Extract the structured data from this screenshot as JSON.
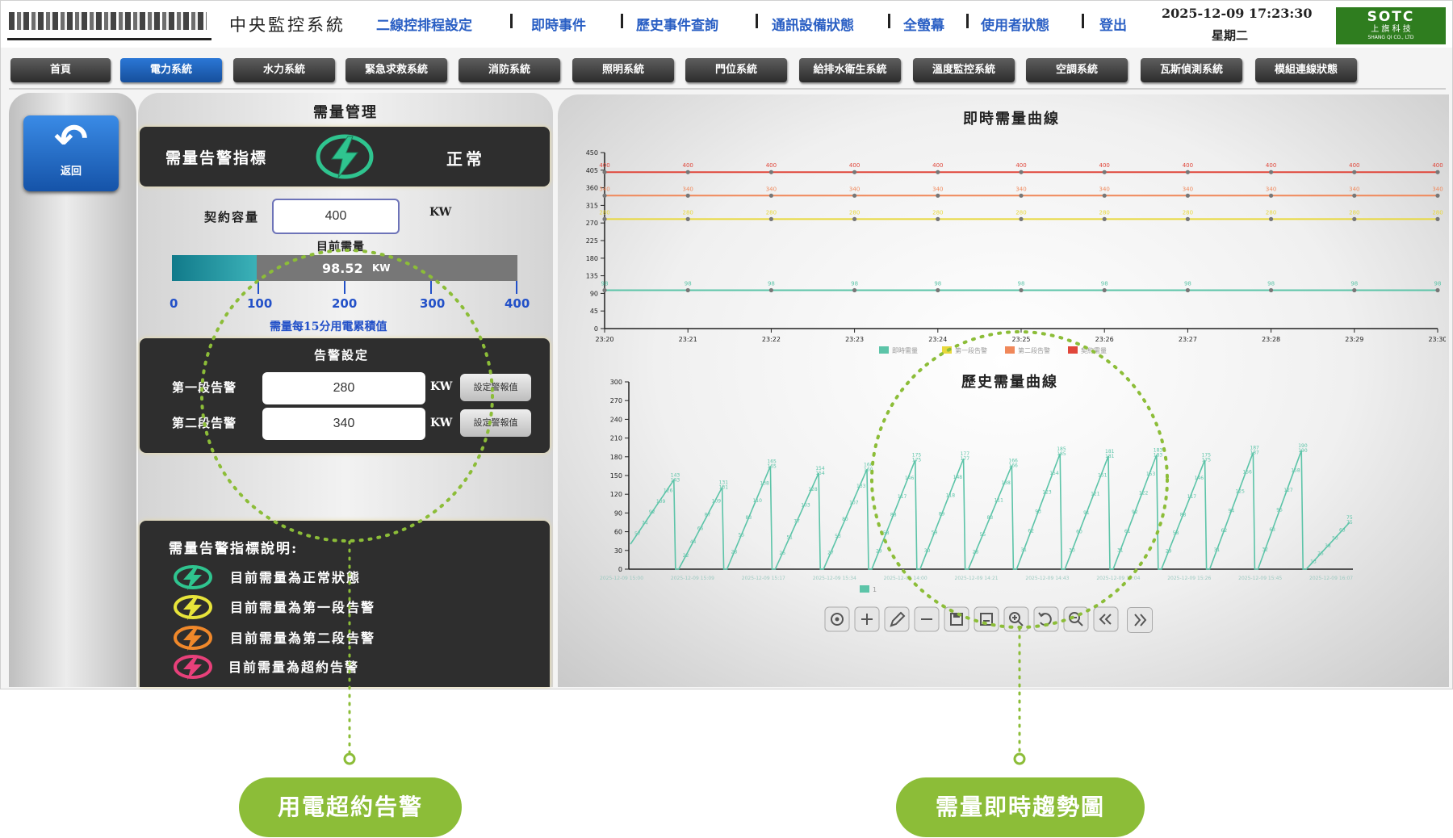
{
  "header": {
    "system_title": "中央監控系統",
    "nav": [
      "二線控排程設定",
      "即時事件",
      "歷史事件查詢",
      "通訊設備狀態",
      "全螢幕",
      "使用者狀態",
      "登出"
    ],
    "datetime": "2025-12-09 17:23:30",
    "weekday": "星期二",
    "brand_name": "SOTC",
    "brand_sub": "上 旗 科 技",
    "brand_sub2": "SHANG QI CO., LTD"
  },
  "tabs": [
    "首頁",
    "電力系統",
    "水力系統",
    "緊急求救系統",
    "消防系統",
    "照明系統",
    "門位系統",
    "給排水衛生系統",
    "溫度監控系統",
    "空調系統",
    "瓦斯偵測系統",
    "模組連線狀態"
  ],
  "active_tab": 1,
  "back_button": "返回",
  "demand": {
    "title": "需量管理",
    "indicator_label": "需量告警指標",
    "indicator_status": "正常",
    "indicator_color": "#2fc48f",
    "contract_label": "契約容量",
    "contract_value": "400",
    "unit": "KW",
    "current_label": "目前需量",
    "current_value": "98.52",
    "bar_fraction": 0.2463,
    "bar_ticks": [
      "0",
      "100",
      "200",
      "300",
      "400"
    ],
    "bar_caption": "需量每15分用電累積值"
  },
  "alarm": {
    "title": "告警設定",
    "rows": [
      {
        "label": "第一段告警",
        "value": "280",
        "unit": "KW",
        "button": "設定警報值"
      },
      {
        "label": "第二段告警",
        "value": "340",
        "unit": "KW",
        "button": "設定警報值"
      }
    ]
  },
  "legend_box": {
    "title": "需量告警指標說明:",
    "items": [
      {
        "text": "目前需量為正常狀態",
        "color": "#2fc48f"
      },
      {
        "text": "目前需量為第一段告警",
        "color": "#e7e43a"
      },
      {
        "text": "目前需量為第二段告警",
        "color": "#f0882a"
      },
      {
        "text": "目前需量為超約告警",
        "color": "#e8407a"
      }
    ]
  },
  "chart_data": [
    {
      "type": "line",
      "title": "即時需量曲線",
      "x": [
        "23:20",
        "23:21",
        "23:22",
        "23:23",
        "23:24",
        "23:25",
        "23:26",
        "23:27",
        "23:28",
        "23:29",
        "23:30"
      ],
      "ylim": [
        0,
        450
      ],
      "yticks": [
        0,
        45,
        90,
        135,
        180,
        225,
        270,
        315,
        360,
        405,
        450
      ],
      "grid": false,
      "legend_position": "bottom",
      "series": [
        {
          "name": "即時需量",
          "color": "#5cc4a8",
          "values": [
            98,
            98,
            98,
            98,
            98,
            98,
            98,
            98,
            98,
            98,
            98
          ]
        },
        {
          "name": "第一段告警",
          "color": "#e8d83c",
          "values": [
            280,
            280,
            280,
            280,
            280,
            280,
            280,
            280,
            280,
            280,
            280
          ]
        },
        {
          "name": "第二段告警",
          "color": "#f0885a",
          "values": [
            340,
            340,
            340,
            340,
            340,
            340,
            340,
            340,
            340,
            340,
            340
          ]
        },
        {
          "name": "契約需量",
          "color": "#e0463a",
          "values": [
            400,
            400,
            400,
            400,
            400,
            400,
            400,
            400,
            400,
            400,
            400
          ]
        }
      ]
    },
    {
      "type": "line",
      "title": "歷史需量曲線",
      "ylim": [
        0,
        300
      ],
      "yticks": [
        0,
        30,
        60,
        90,
        120,
        150,
        180,
        210,
        240,
        270,
        300
      ],
      "grid": false,
      "legend_position": "bottom",
      "x_labels": [
        "2025-12-09 15:00",
        "2025-12-09 15:09",
        "2025-12-09 15:17",
        "2025-12-09 15:34",
        "2025-12-09 14:00",
        "2025-12-09 14:21",
        "2025-12-09 14:43",
        "2025-12-09 15:04",
        "2025-12-09 15:26",
        "2025-12-09 15:45",
        "2025-12-09 16:07"
      ],
      "series": [
        {
          "name": "1",
          "color": "#5cc4a8",
          "cycle_peaks": [
            143,
            131,
            165,
            154,
            160,
            175,
            177,
            166,
            185,
            181,
            183,
            175,
            187,
            190,
            75
          ],
          "cycle_starts": [
            40,
            0,
            0,
            0,
            0,
            0,
            0,
            0,
            0,
            0,
            0,
            0,
            0,
            0,
            0
          ]
        }
      ]
    }
  ],
  "toolbar_icons": [
    "settings-icon",
    "plus-icon",
    "pencil-icon",
    "minus-icon",
    "save-icon",
    "save-as-icon",
    "zoom-in-icon",
    "undo-icon",
    "zoom-out-icon",
    "double-left-icon",
    "double-right-icon"
  ],
  "callouts": [
    {
      "label": "用電超約告警"
    },
    {
      "label": "需量即時趨勢圖"
    }
  ],
  "colors": {
    "accent": "#8cbd38",
    "active_tab": "#2b77d6",
    "nav_text": "#2a5fc4",
    "brand": "#2f7d1f"
  }
}
